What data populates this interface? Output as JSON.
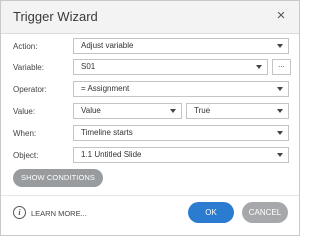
{
  "dialog": {
    "title": "Trigger Wizard",
    "close_glyph": "×"
  },
  "rows": {
    "action": {
      "label": "Action:",
      "value": "Adjust variable"
    },
    "variable": {
      "label": "Variable:",
      "value": "S01",
      "more": "..."
    },
    "operator": {
      "label": "Operator:",
      "value": "= Assignment"
    },
    "value": {
      "label": "Value:",
      "type": "Value",
      "value": "True"
    },
    "when": {
      "label": "When:",
      "value": "Timeline starts"
    },
    "object": {
      "label": "Object:",
      "value": "1.1 Untitled Slide"
    }
  },
  "buttons": {
    "show_conditions": "SHOW CONDITIONS",
    "learn_more": "LEARN MORE...",
    "ok": "OK",
    "cancel": "CANCEL"
  },
  "icons": {
    "info": "i",
    "dropdown": "chevron-down-icon"
  },
  "colors": {
    "primary": "#2b7bd0",
    "secondary": "#a6a8ab",
    "show_conditions": "#999c9f"
  }
}
